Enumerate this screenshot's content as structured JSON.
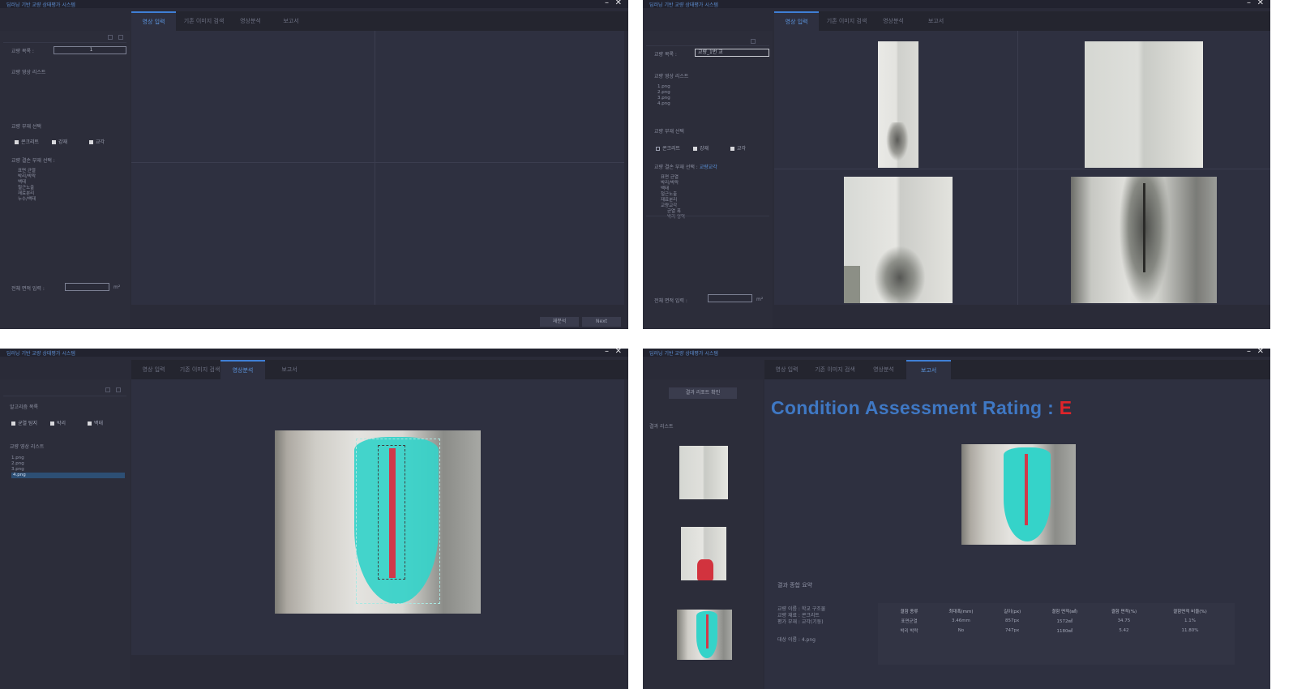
{
  "app_title": "딥러닝 기반 교량 상태평가 시스템",
  "tabs": [
    "영상 입력",
    "기존 이미지 검색",
    "영상분석",
    "보고서"
  ],
  "window1": {
    "active_tab": 0,
    "bridge_name_label": "교량 목록 :",
    "bridge_name_value": "1",
    "image_list_label": "교량 영상 리스트",
    "member_label": "교량 부재 선택",
    "members": [
      "콘크리트",
      "강재",
      "교각"
    ],
    "damage_label": "교량 결손 부재 선택 :",
    "damage_items": [
      "표면 균열",
      "박리/박락",
      "백태",
      "철근노출",
      "재료분리",
      "누수/백태"
    ],
    "area_label": "전체 면적 입력 :",
    "area_unit": "m²",
    "prev_button": "재분석",
    "next_button": "Next"
  },
  "window2": {
    "active_tab": 0,
    "bridge_name_label": "교량 목록 :",
    "bridge_name_value": "교량_1번 교",
    "image_list_label": "교량 영상 리스트",
    "images": [
      "1.png",
      "2.png",
      "3.png",
      "4.png"
    ],
    "member_label": "교량 부재 선택",
    "members": [
      "콘크리트",
      "강재",
      "교각"
    ],
    "damage_label": "교량 결손 부재 선택 :",
    "damage_selected": "교량교각",
    "damage_items": [
      "표면 균열",
      "박리/박락",
      "백태",
      "철근노출",
      "재료분리",
      "교량교각"
    ],
    "damage_subitems": [
      "균열 폭",
      "박리 영역"
    ],
    "area_label": "전체 면적 입력 :",
    "area_unit": "m²"
  },
  "window3": {
    "active_tab": 2,
    "algo_label": "알고리즘 목록",
    "algos": [
      "균열 탐지",
      "박리",
      "백태"
    ],
    "image_list_label": "교량 영상 리스트",
    "images": [
      "1.png",
      "2.png",
      "3.png",
      "4.png"
    ],
    "selected_image": 3
  },
  "window4": {
    "active_tab": 3,
    "report_button": "결과 리포트 확인",
    "result_list_label": "결과 리스트",
    "rating_label": "Condition Assessment Rating : ",
    "rating_value": "E",
    "summary_heading": "결과 종합 요약",
    "info_lines": [
      "교량 이름 : 학교 구조물",
      "교량 재료 : 콘크리트",
      "평가 부재 : 교각(기둥)"
    ],
    "image_name": "대상 이름 : 4.png",
    "table": {
      "headers": [
        "결함 종류",
        "최대폭(mm)",
        "길이(px)",
        "결함 면적(㎟)",
        "결함 면적(%)",
        "결함면적 비율(%)"
      ],
      "rows": [
        [
          "표면균열",
          "3.46mm",
          "857px",
          "1572㎟",
          "34.75",
          "1.1%"
        ],
        [
          "박리 박락",
          "No",
          "747px",
          "1180㎟",
          "5.42",
          "11.80%"
        ]
      ]
    }
  },
  "colors": {
    "accent": "#3f7fd6",
    "rating_text": "#3f78c4",
    "rating_value": "#e0242a",
    "crack_mask": "#35d3c9",
    "crack_line": "#d0394a"
  }
}
